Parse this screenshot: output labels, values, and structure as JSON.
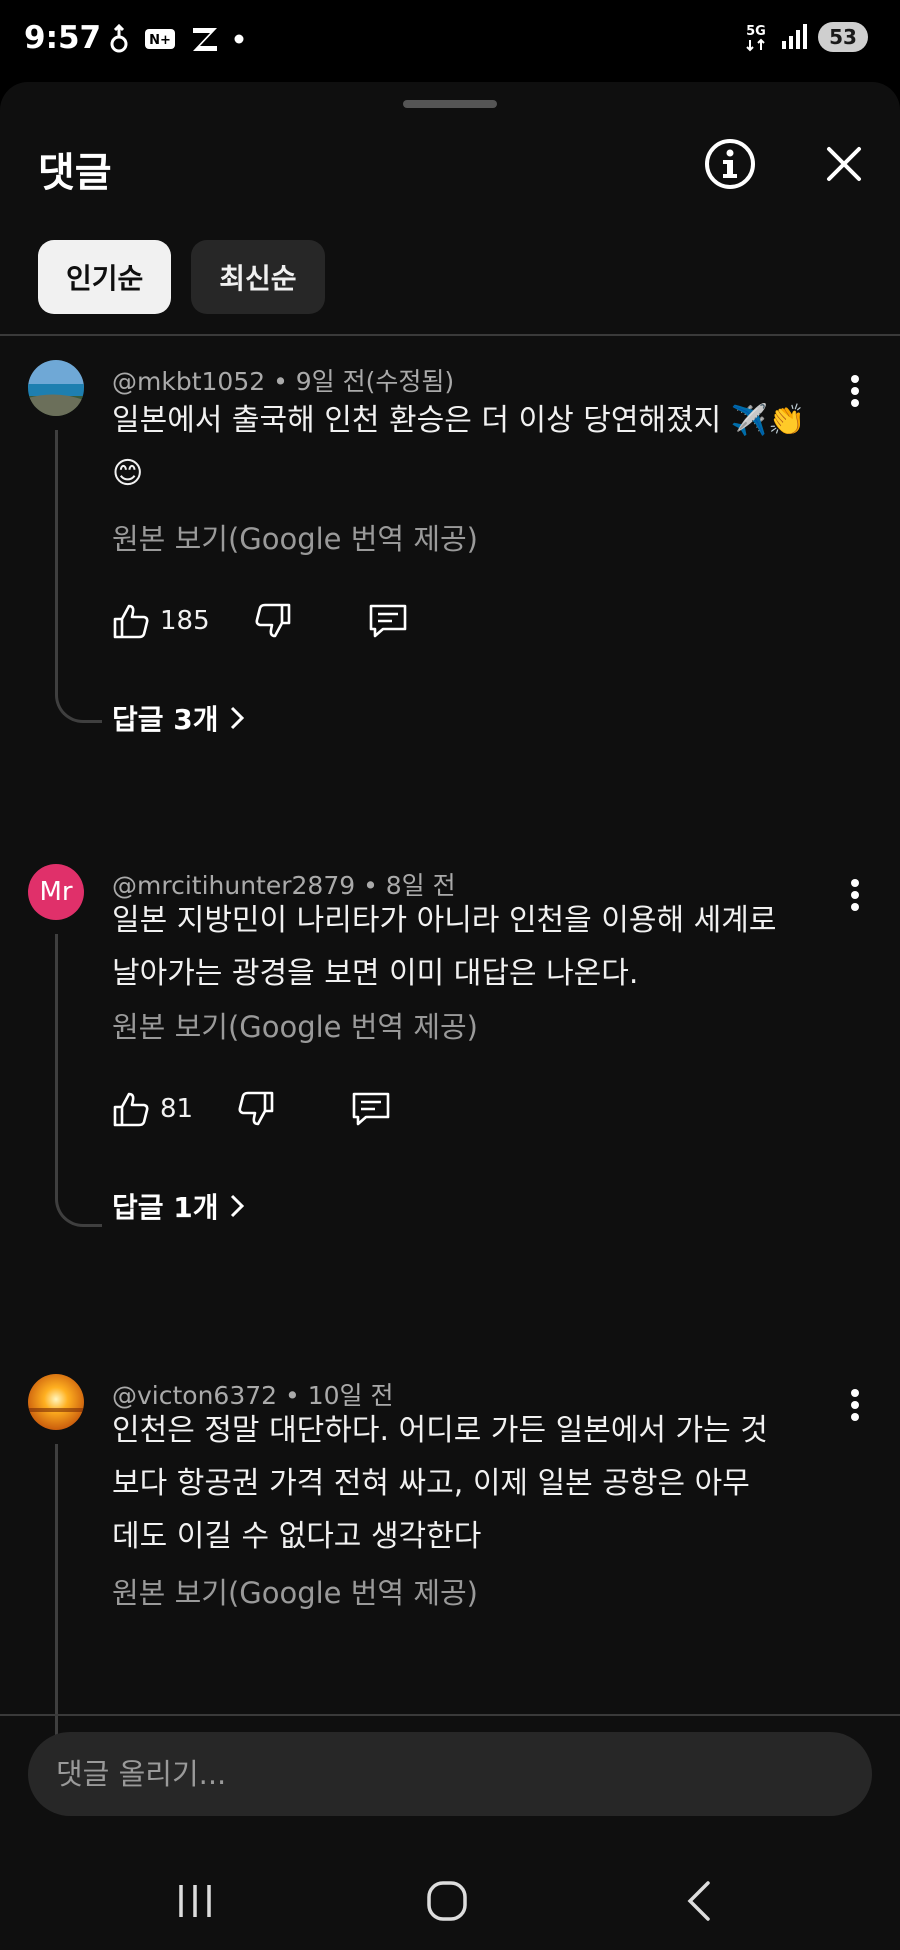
{
  "status_bar": {
    "time": "9:57",
    "battery": "53",
    "network": "5G"
  },
  "sheet": {
    "title": "댓글",
    "sort_chips": [
      {
        "label": "인기순"
      },
      {
        "label": "최신순"
      }
    ]
  },
  "comments": [
    {
      "author": "@mkbt1052",
      "time": "9일 전(수정됨)",
      "text": "일본에서 출국해 인천 환승은 더 이상 당연해졌지 ✈️👏😊",
      "translate_label": "원본 보기(Google 번역 제공)",
      "likes": "185",
      "replies_label": "답글 3개"
    },
    {
      "author": "@mrcitihunter2879",
      "time": "8일 전",
      "avatar_text": "Mr",
      "text": "일본 지방민이 나리타가 아니라 인천을 이용해 세계로 날아가는 광경을 보면 이미 대답은 나온다.",
      "translate_label": "원본 보기(Google 번역 제공)",
      "likes": "81",
      "replies_label": "답글 1개"
    },
    {
      "author": "@victon6372",
      "time": "10일 전",
      "text": "인천은 정말 대단하다. 어디로 가든 일본에서 가는 것보다 항공권 가격 전혀 싸고, 이제 일본 공항은 아무데도 이길 수 없다고 생각한다",
      "translate_label": "원본 보기(Google 번역 제공)"
    }
  ],
  "input": {
    "placeholder": "댓글 올리기..."
  },
  "colors": {
    "background": "#0f0f0f",
    "avatar_mr": "#e0306a",
    "chip_active": "#f1f1f1"
  }
}
